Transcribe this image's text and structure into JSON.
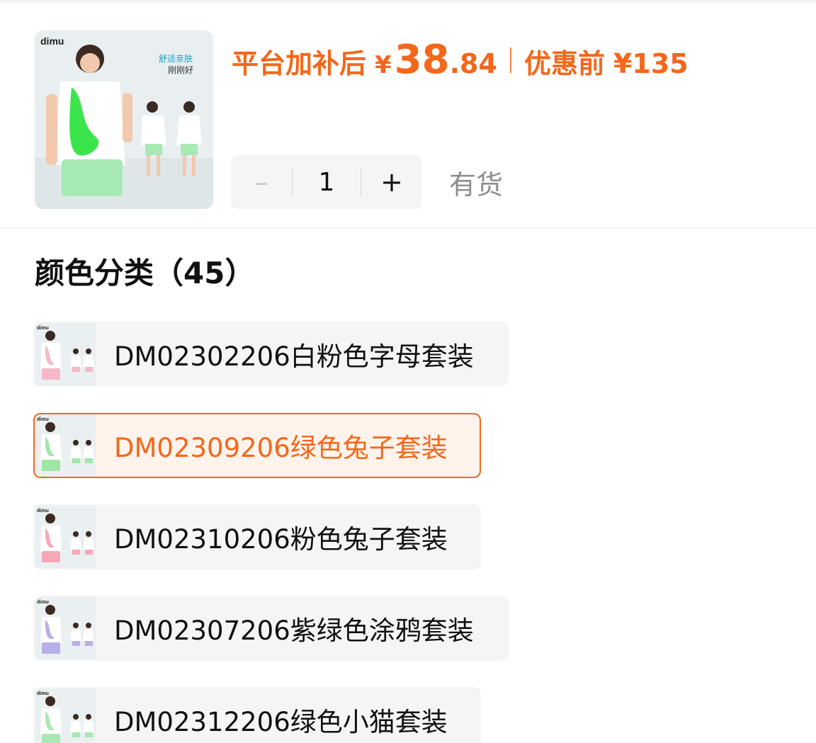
{
  "product": {
    "thumb_brand": "dimu",
    "thumb_tagline_1": "舒适亲肤",
    "thumb_tagline_2": "刚刚好"
  },
  "price": {
    "prefix": "平台加补后",
    "currency": "¥",
    "integer": "38",
    "decimal": ".84",
    "original_label": "优惠前",
    "original_price": "¥135",
    "color": "#f4671a"
  },
  "quantity": {
    "minus_label": "–",
    "value": "1",
    "plus_label": "+"
  },
  "stock_status": "有货",
  "color_section": {
    "title": "颜色分类（45）"
  },
  "options": [
    {
      "label": "DM02302206白粉色字母套装",
      "selected": false,
      "swatch": "#f6b8c8",
      "thumb_brand": "dimu"
    },
    {
      "label": "DM02309206绿色兔子套装",
      "selected": true,
      "swatch": "#9fe6a8",
      "thumb_brand": "dimu"
    },
    {
      "label": "DM02310206粉色兔子套装",
      "selected": false,
      "swatch": "#f7a8b8",
      "thumb_brand": "dimu"
    },
    {
      "label": "DM02307206紫绿色涂鸦套装",
      "selected": false,
      "swatch": "#b7b0e8",
      "thumb_brand": "dimu"
    },
    {
      "label": "DM02312206绿色小猫套装",
      "selected": false,
      "swatch": "#a9e8b2",
      "thumb_brand": "dimu"
    }
  ]
}
